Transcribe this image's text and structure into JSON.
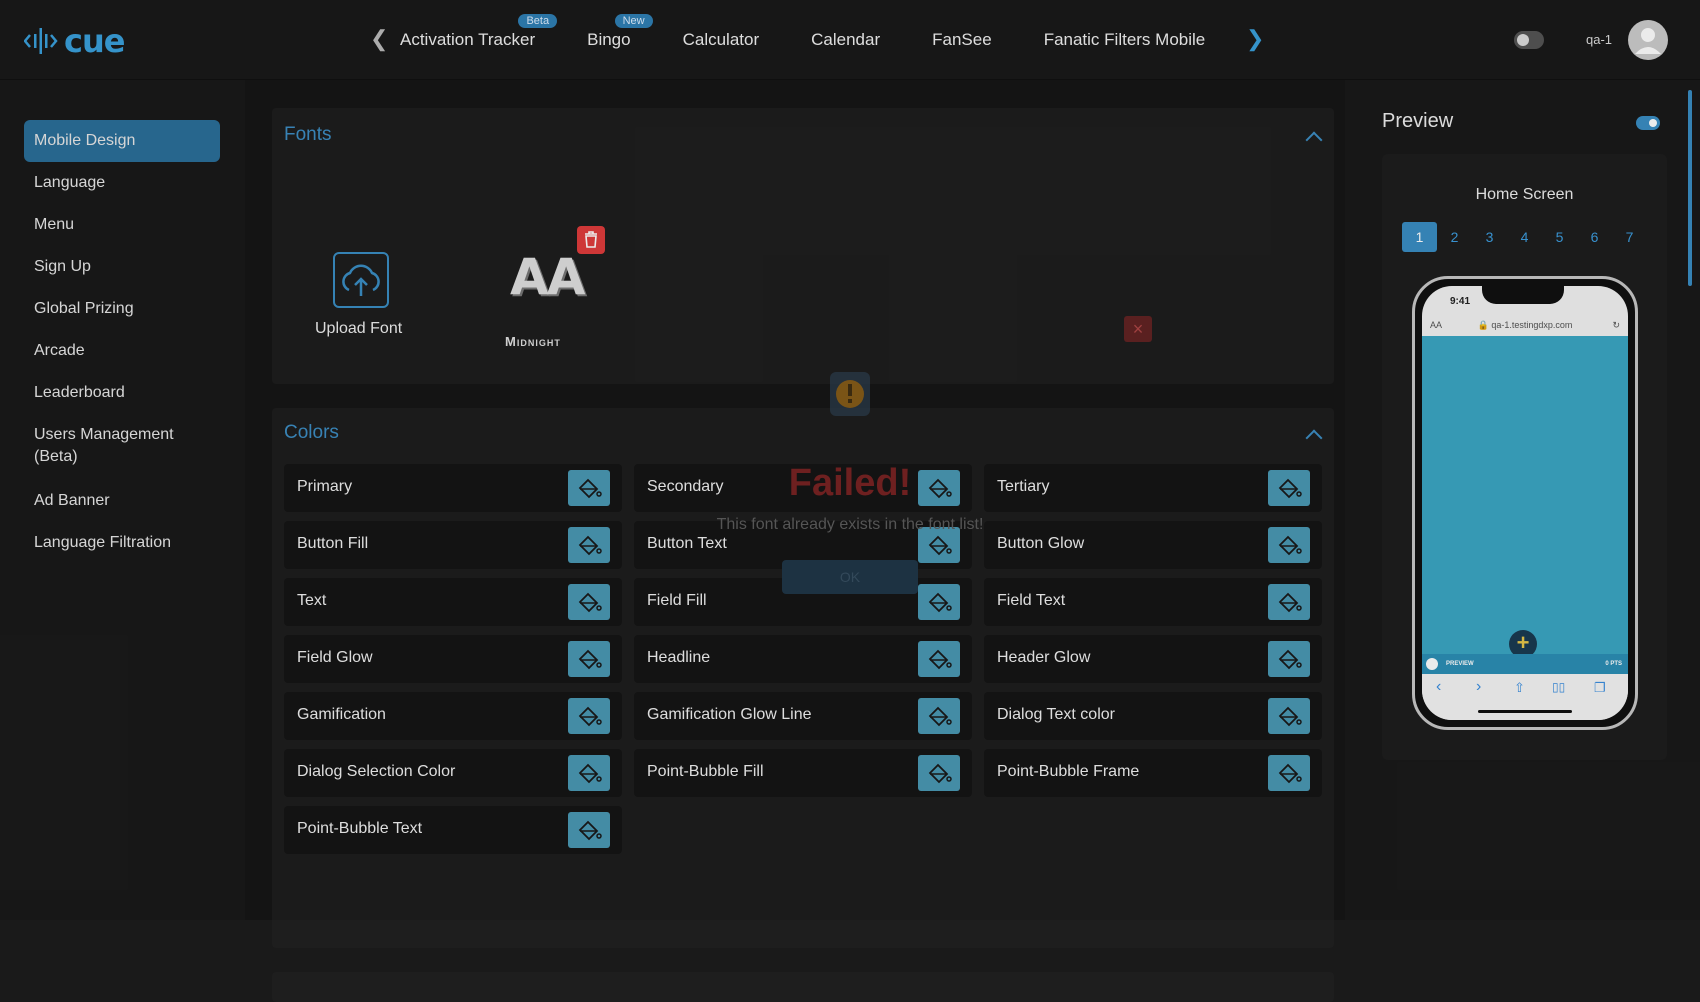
{
  "app": {
    "logo_text": "cue",
    "user": "qa-1"
  },
  "nav": {
    "tabs": [
      {
        "label": "Activation Tracker",
        "badge": "Beta"
      },
      {
        "label": "Bingo",
        "badge": "New"
      },
      {
        "label": "Calculator",
        "badge": ""
      },
      {
        "label": "Calendar",
        "badge": ""
      },
      {
        "label": "FanSee",
        "badge": ""
      },
      {
        "label": "Fanatic Filters Mobile",
        "badge": ""
      }
    ]
  },
  "sidebar": {
    "items": [
      {
        "label": "Mobile Design",
        "active": true
      },
      {
        "label": "Language"
      },
      {
        "label": "Menu"
      },
      {
        "label": "Sign Up"
      },
      {
        "label": "Global Prizing"
      },
      {
        "label": "Arcade"
      },
      {
        "label": "Leaderboard"
      },
      {
        "label": "Users Management (Beta)"
      },
      {
        "label": "Ad Banner"
      },
      {
        "label": "Language Filtration"
      }
    ]
  },
  "fonts": {
    "title": "Fonts",
    "upload_label": "Upload Font",
    "font_preview": "AA",
    "font_name": "Midnight"
  },
  "colors": {
    "title": "Colors",
    "items": [
      "Primary",
      "Secondary",
      "Tertiary",
      "Button Fill",
      "Button Text",
      "Button Glow",
      "Text",
      "Field Fill",
      "Field Text",
      "Field Glow",
      "Headline",
      "Header Glow",
      "Gamification",
      "Gamification Glow Line",
      "Dialog Text color",
      "Dialog Selection Color",
      "Point-Bubble Fill",
      "Point-Bubble Frame",
      "Point-Bubble Text"
    ]
  },
  "preview": {
    "title": "Preview",
    "screen_name": "Home Screen",
    "screen_tabs": [
      "1",
      "2",
      "3",
      "4",
      "5",
      "6",
      "7"
    ],
    "active_tab": "1",
    "phone": {
      "time": "9:41",
      "url": "qa-1.testingdxp.com",
      "url_prefix": "AA",
      "bar_left": "PREVIEW",
      "bar_right": "0 PTS"
    }
  },
  "dialog": {
    "title": "Failed!",
    "message": "This font already exists in the font list!",
    "ok_label": "OK",
    "close_label": "×"
  },
  "accent_color": "#3a8ec4"
}
